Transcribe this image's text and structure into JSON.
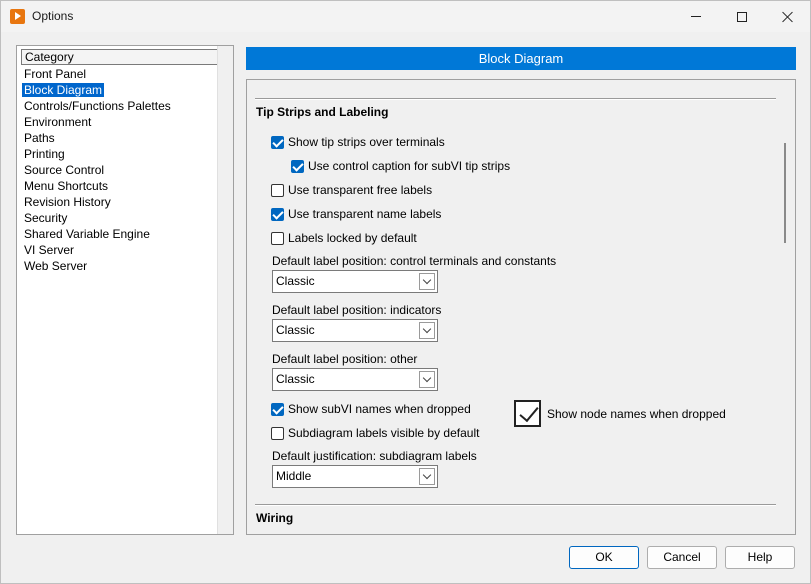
{
  "window": {
    "title": "Options",
    "minimize_glyph": "—",
    "maximize_glyph": "□",
    "close_glyph": "✕"
  },
  "category": {
    "header": "Category",
    "items": [
      {
        "label": "Front Panel",
        "selected": false
      },
      {
        "label": "Block Diagram",
        "selected": true
      },
      {
        "label": "Controls/Functions Palettes",
        "selected": false
      },
      {
        "label": "Environment",
        "selected": false
      },
      {
        "label": "Paths",
        "selected": false
      },
      {
        "label": "Printing",
        "selected": false
      },
      {
        "label": "Source Control",
        "selected": false
      },
      {
        "label": "Menu Shortcuts",
        "selected": false
      },
      {
        "label": "Revision History",
        "selected": false
      },
      {
        "label": "Security",
        "selected": false
      },
      {
        "label": "Shared Variable Engine",
        "selected": false
      },
      {
        "label": "VI Server",
        "selected": false
      },
      {
        "label": "Web Server",
        "selected": false
      }
    ]
  },
  "main": {
    "section_title": "Block Diagram",
    "groups": {
      "tip_strips": "Tip Strips and Labeling",
      "wiring": "Wiring"
    },
    "options": {
      "show_tip_strips": {
        "label": "Show tip strips over terminals",
        "checked": true
      },
      "use_control_caption": {
        "label": "Use control caption for subVI tip strips",
        "checked": true
      },
      "transparent_free_labels": {
        "label": "Use transparent free labels",
        "checked": false
      },
      "transparent_name_labels": {
        "label": "Use transparent name labels",
        "checked": true
      },
      "labels_locked": {
        "label": "Labels locked by default",
        "checked": false
      },
      "show_subvi_names": {
        "label": "Show subVI names when dropped",
        "checked": true
      },
      "subdiagram_labels_visible": {
        "label": "Subdiagram labels visible by default",
        "checked": false
      },
      "show_node_names": {
        "label": "Show node names when dropped",
        "checked": true
      }
    },
    "dropdowns": {
      "control_terminals": {
        "label": "Default label position: control terminals and constants",
        "value": "Classic"
      },
      "indicators": {
        "label": "Default label position: indicators",
        "value": "Classic"
      },
      "other": {
        "label": "Default label position: other",
        "value": "Classic"
      },
      "justification": {
        "label": "Default justification: subdiagram labels",
        "value": "Middle"
      }
    }
  },
  "buttons": {
    "ok": "OK",
    "cancel": "Cancel",
    "help": "Help"
  },
  "colors": {
    "accent": "#0078d7",
    "selection": "#0066cc",
    "check": "#0067c0"
  }
}
